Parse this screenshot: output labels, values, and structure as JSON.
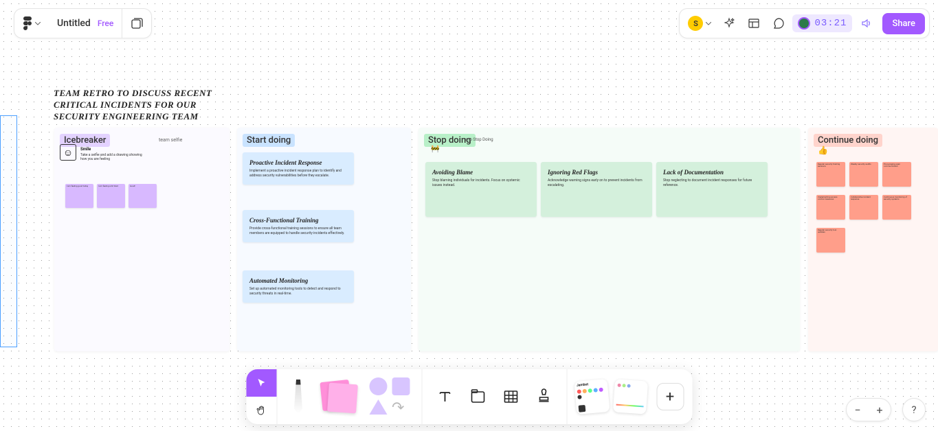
{
  "header": {
    "title": "Untitled",
    "badge": "Free",
    "avatar_initial": "S",
    "timer": "03:21",
    "share_label": "Share"
  },
  "board": {
    "title": "TEAM RETRO TO DISCUSS RECENT CRITICAL INCIDENTS FOR OUR SECURITY ENGINEERING TEAM",
    "icebreaker": {
      "label": "Icebreaker",
      "sublabel": "team selfie",
      "heading": "Smile",
      "desc": "Take a selfie and add a drawing showing how you are feeling",
      "stickies": [
        "I am feeling good today",
        "I am feeling a bit tired",
        "Good!"
      ]
    },
    "start": {
      "label": "Start doing",
      "cards": [
        {
          "title": "Proactive Incident Response",
          "desc": "Implement a proactive incident response plan to identify and address security vulnerabilities before they escalate."
        },
        {
          "title": "Cross-Functional Training",
          "desc": "Provide cross-functional training sessions to ensure all team members are equipped to handle security incidents effectively."
        },
        {
          "title": "Automated Monitoring",
          "desc": "Set up automated monitoring tools to detect and respond to security threats in real-time."
        }
      ]
    },
    "stop": {
      "label": "Stop doing",
      "sublabel": "s to Stop Doing",
      "emoji": "🚧",
      "cards": [
        {
          "title": "Avoiding Blame",
          "desc": "Stop blaming individuals for incidents. Focus on systemic issues instead."
        },
        {
          "title": "Ignoring Red Flags",
          "desc": "Acknowledge warning signs early on to prevent incidents from escalating."
        },
        {
          "title": "Lack of Documentation",
          "desc": "Stop neglecting to document incident responses for future reference."
        }
      ]
    },
    "continue": {
      "label": "Continue doing",
      "sublabel": "s",
      "emoji": "👍",
      "stickies": [
        "Regular security training sessions",
        "Weekly security audits",
        "Encouraging open communication",
        "Implementing access control measures",
        "Collaborative incident response",
        "Continuous monitoring of security systems",
        "Regular security tool updates"
      ]
    }
  },
  "zoom": {
    "minus": "−",
    "plus": "+"
  },
  "help": "?"
}
